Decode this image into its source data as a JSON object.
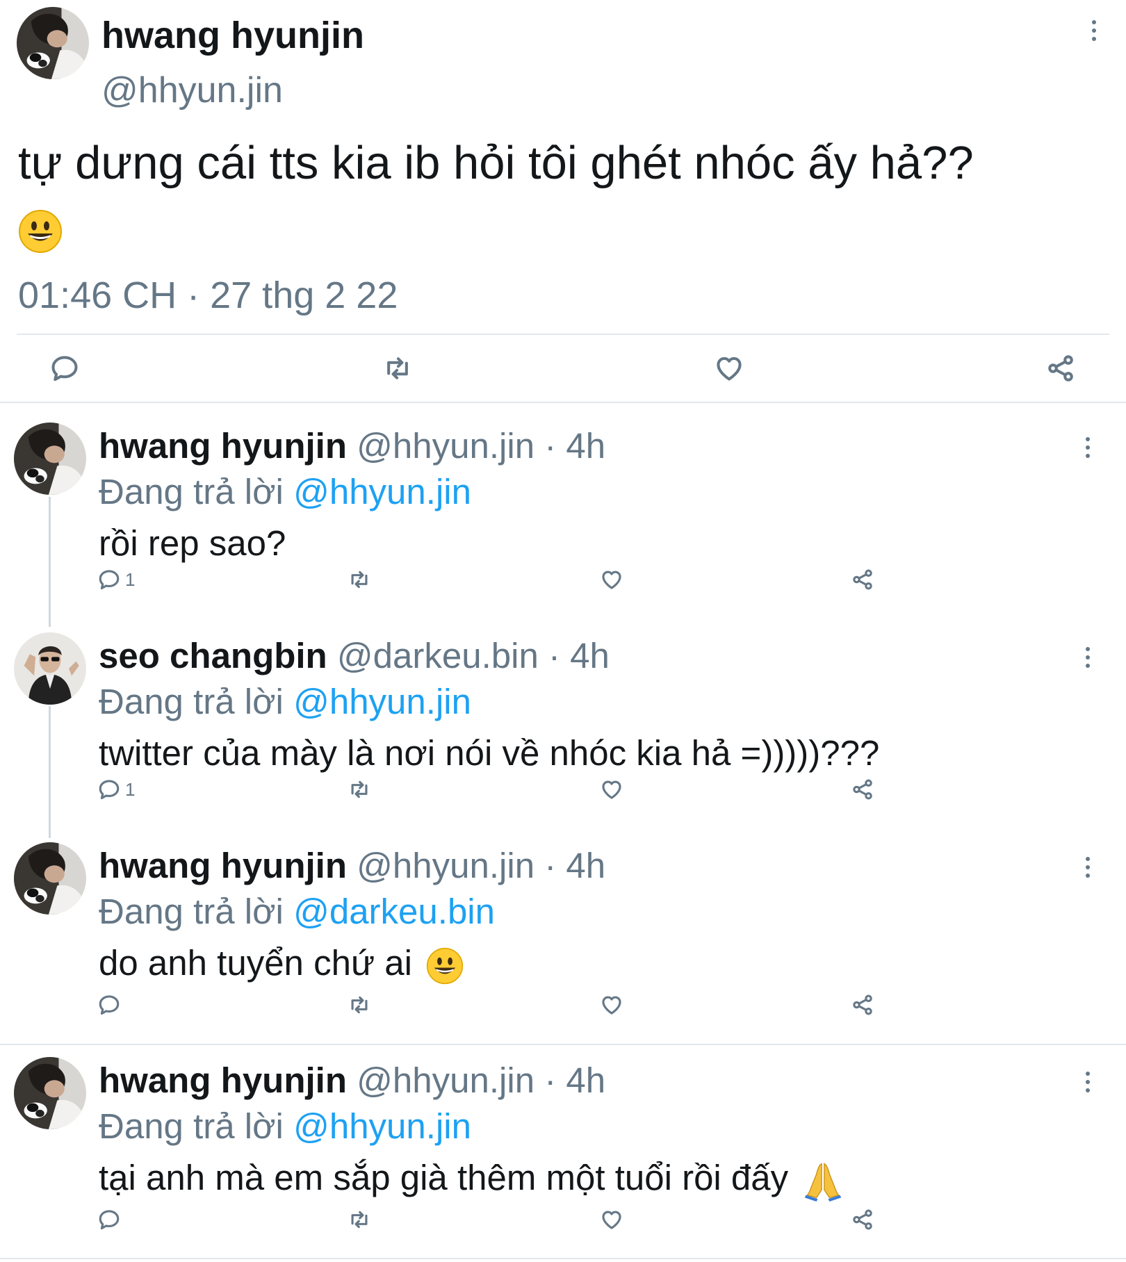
{
  "main_tweet": {
    "author_name": "hwang hyunjin",
    "author_handle": "@hhyun.jin",
    "text": "tự dưng cái tts kia ib hỏi tôi ghét nhóc ấy hả??",
    "emoji": "smiley-emoji",
    "timestamp": "01:46 CH · 27 thg 2 22",
    "actions": [
      "reply-icon",
      "retweet-icon",
      "like-icon",
      "share-icon"
    ]
  },
  "replies": [
    {
      "author_name": "hwang hyunjin",
      "author_handle": "@hhyun.jin",
      "age": "· 4h",
      "replying_label": "Đang trả lời",
      "replying_to": "@hhyun.jin",
      "text": "rồi rep sao?",
      "reply_count": "1"
    },
    {
      "author_name": "seo changbin",
      "author_handle": "@darkeu.bin",
      "age": "· 4h",
      "replying_label": "Đang trả lời",
      "replying_to": "@hhyun.jin",
      "text": "twitter của mày là nơi nói về nhóc kia hả =)))))???",
      "reply_count": "1"
    },
    {
      "author_name": "hwang hyunjin",
      "author_handle": "@hhyun.jin",
      "age": "· 4h",
      "replying_label": "Đang trả lời",
      "replying_to": "@darkeu.bin",
      "text": "do anh tuyển chứ ai",
      "emoji": "smiley-emoji",
      "reply_count": ""
    },
    {
      "author_name": "hwang hyunjin",
      "author_handle": "@hhyun.jin",
      "age": "· 4h",
      "replying_label": "Đang trả lời",
      "replying_to": "@hhyun.jin",
      "text": "tại anh mà em sắp già thêm một tuổi rồi đấy",
      "emoji": "folded-hands-emoji",
      "reply_count": ""
    }
  ],
  "colors": {
    "text": "#14171a",
    "secondary": "#657786",
    "link": "#1da1f2",
    "divider": "#e1e8ed"
  }
}
